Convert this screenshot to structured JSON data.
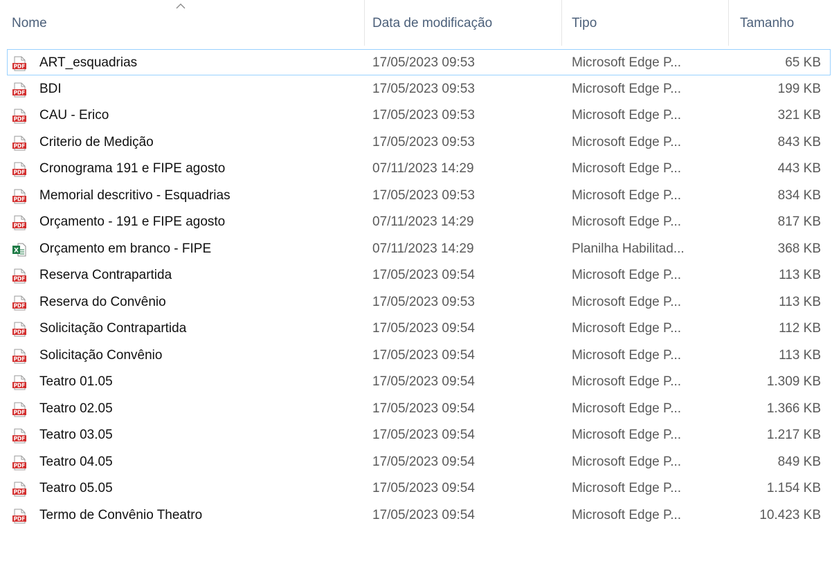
{
  "columns": {
    "name": "Nome",
    "date": "Data de modificação",
    "type": "Tipo",
    "size": "Tamanho"
  },
  "sort": {
    "column": "name",
    "direction": "ascending"
  },
  "icons": {
    "pdf": {
      "name": "pdf-file-icon",
      "color": "#d32f2f",
      "label": "PDF"
    },
    "excel": {
      "name": "excel-file-icon",
      "color": "#1d7a45",
      "label": "X"
    }
  },
  "files": [
    {
      "name": "ART_esquadrias",
      "date": "17/05/2023 09:53",
      "type": "Microsoft Edge P...",
      "size": "65 KB",
      "icon": "pdf"
    },
    {
      "name": "BDI",
      "date": "17/05/2023 09:53",
      "type": "Microsoft Edge P...",
      "size": "199 KB",
      "icon": "pdf"
    },
    {
      "name": "CAU - Erico",
      "date": "17/05/2023 09:53",
      "type": "Microsoft Edge P...",
      "size": "321 KB",
      "icon": "pdf"
    },
    {
      "name": "Criterio de Medição",
      "date": "17/05/2023 09:53",
      "type": "Microsoft Edge P...",
      "size": "843 KB",
      "icon": "pdf"
    },
    {
      "name": "Cronograma 191 e FIPE agosto",
      "date": "07/11/2023 14:29",
      "type": "Microsoft Edge P...",
      "size": "443 KB",
      "icon": "pdf"
    },
    {
      "name": "Memorial descritivo - Esquadrias",
      "date": "17/05/2023 09:53",
      "type": "Microsoft Edge P...",
      "size": "834 KB",
      "icon": "pdf"
    },
    {
      "name": "Orçamento - 191 e FIPE agosto",
      "date": "07/11/2023 14:29",
      "type": "Microsoft Edge P...",
      "size": "817 KB",
      "icon": "pdf"
    },
    {
      "name": "Orçamento em branco - FIPE",
      "date": "07/11/2023 14:29",
      "type": "Planilha Habilitad...",
      "size": "368 KB",
      "icon": "excel"
    },
    {
      "name": "Reserva Contrapartida",
      "date": "17/05/2023 09:54",
      "type": "Microsoft Edge P...",
      "size": "113 KB",
      "icon": "pdf"
    },
    {
      "name": "Reserva do Convênio",
      "date": "17/05/2023 09:53",
      "type": "Microsoft Edge P...",
      "size": "113 KB",
      "icon": "pdf"
    },
    {
      "name": "Solicitação Contrapartida",
      "date": "17/05/2023 09:54",
      "type": "Microsoft Edge P...",
      "size": "112 KB",
      "icon": "pdf"
    },
    {
      "name": "Solicitação Convênio",
      "date": "17/05/2023 09:54",
      "type": "Microsoft Edge P...",
      "size": "113 KB",
      "icon": "pdf"
    },
    {
      "name": "Teatro 01.05",
      "date": "17/05/2023 09:54",
      "type": "Microsoft Edge P...",
      "size": "1.309 KB",
      "icon": "pdf"
    },
    {
      "name": "Teatro 02.05",
      "date": "17/05/2023 09:54",
      "type": "Microsoft Edge P...",
      "size": "1.366 KB",
      "icon": "pdf"
    },
    {
      "name": "Teatro 03.05",
      "date": "17/05/2023 09:54",
      "type": "Microsoft Edge P...",
      "size": "1.217 KB",
      "icon": "pdf"
    },
    {
      "name": "Teatro 04.05",
      "date": "17/05/2023 09:54",
      "type": "Microsoft Edge P...",
      "size": "849 KB",
      "icon": "pdf"
    },
    {
      "name": "Teatro 05.05",
      "date": "17/05/2023 09:54",
      "type": "Microsoft Edge P...",
      "size": "1.154 KB",
      "icon": "pdf"
    },
    {
      "name": "Termo de Convênio Theatro",
      "date": "17/05/2023 09:54",
      "type": "Microsoft Edge P...",
      "size": "10.423 KB",
      "icon": "pdf"
    }
  ],
  "selected_index": 0
}
